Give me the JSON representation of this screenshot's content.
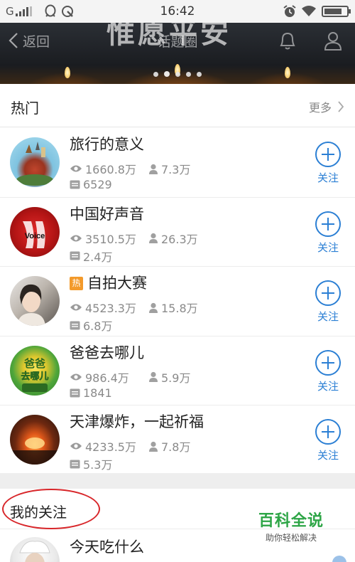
{
  "status_bar": {
    "carrier": "G",
    "time": "16:42"
  },
  "banner": {
    "back_label": "返回",
    "title": "话题圈",
    "overlay_text": "惟愿平安",
    "carousel_dots": 5,
    "active_dot": 1
  },
  "hot": {
    "title": "热门",
    "more_label": "更多",
    "follow_label": "关注",
    "hot_badge": "热",
    "topics": [
      {
        "name": "旅行的意义",
        "views": "1660.8万",
        "users": "7.3万",
        "posts": "6529",
        "hot": false
      },
      {
        "name": "中国好声音",
        "views": "3510.5万",
        "users": "26.3万",
        "posts": "2.4万",
        "hot": false
      },
      {
        "name": "自拍大赛",
        "views": "4523.3万",
        "users": "15.8万",
        "posts": "6.8万",
        "hot": true
      },
      {
        "name": "爸爸去哪儿",
        "views": "986.4万",
        "users": "5.9万",
        "posts": "1841",
        "hot": false
      },
      {
        "name": "天津爆炸，一起祈福",
        "views": "4233.5万",
        "users": "7.8万",
        "posts": "5.3万",
        "hot": false
      }
    ]
  },
  "mine": {
    "title": "我的关注",
    "topics": [
      {
        "name": "今天吃什么"
      }
    ]
  },
  "watermark": {
    "main": "百科全说",
    "sub": "助你轻松解决"
  },
  "colors": {
    "accent": "#2b7fd4",
    "hot_badge": "#f39a2b",
    "annotation": "#d8262a",
    "watermark": "#2da546"
  }
}
